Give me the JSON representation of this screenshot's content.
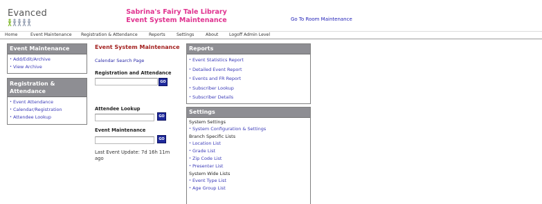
{
  "brand": {
    "logo_text": "Evanced"
  },
  "header": {
    "library_name": "Sabrina's Fairy Tale Library",
    "page_name": "Event System Maintenance",
    "room_link": "Go To Room Maintenance"
  },
  "nav": {
    "items": [
      "Home",
      "Event Maintenance",
      "Registration & Attendance",
      "Reports",
      "Settings",
      "About",
      "Logoff Admin Level"
    ]
  },
  "event_maintenance_panel": {
    "title": "Event Maintenance",
    "links": [
      "Add/Edit/Archive",
      "View Archive"
    ]
  },
  "registration_panel": {
    "title": "Registration & Attendance",
    "links": [
      "Event Attendance",
      "Calendar/Registration",
      "Attendee Lookup"
    ]
  },
  "middle": {
    "title": "Event System Maintenance",
    "calendar_link": "Calendar Search Page",
    "reg_label": "Registration and Attendance",
    "attendee_label": "Attendee Lookup",
    "event_label": "Event Maintenance",
    "go_label": "GO",
    "last_update": "Last Event Update: 7d 16h 11m ago"
  },
  "reports_panel": {
    "title": "Reports",
    "links": [
      "Event Statistics Report",
      "Detailed Event Report",
      "Events and FR Report",
      "Subscriber Lookup",
      "Subscriber Details"
    ]
  },
  "settings_panel": {
    "title": "Settings",
    "system_settings_label": "System Settings",
    "system_links": [
      "System Configuration & Settings"
    ],
    "branch_label": "Branch Specific Lists",
    "branch_links": [
      "Location List",
      "Grade List",
      "Zip Code List",
      "Presenter List"
    ],
    "system_wide_label": "System Wide Lists",
    "system_wide_links": [
      "Event Type List",
      "Age Group List"
    ]
  }
}
